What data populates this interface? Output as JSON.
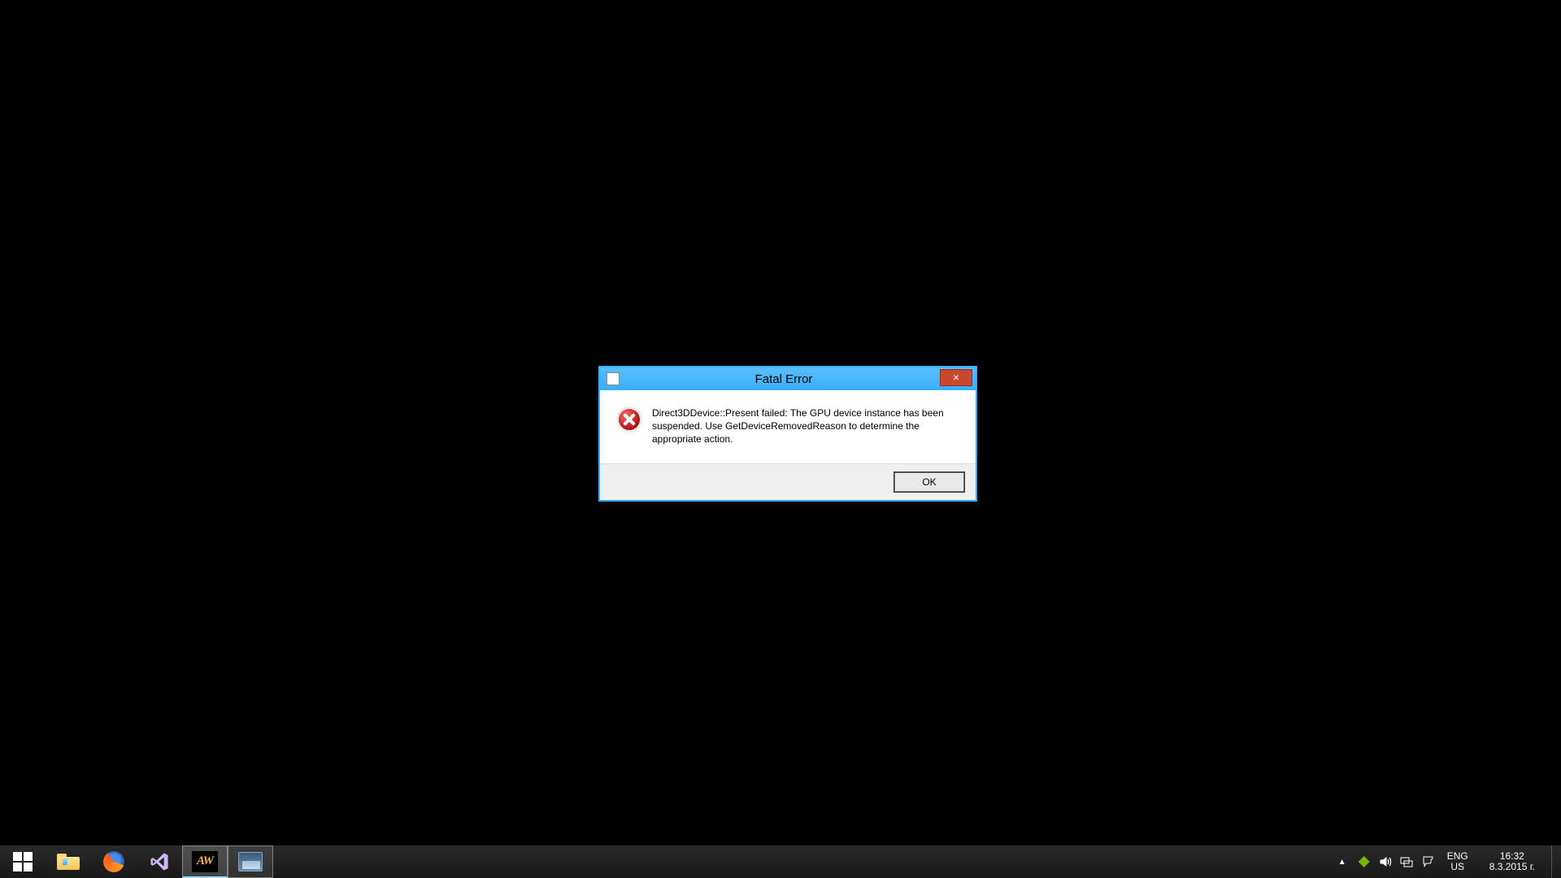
{
  "dialog": {
    "title": "Fatal Error",
    "message": "Direct3DDevice::Present failed: The GPU device instance has been suspended. Use GetDeviceRemovedReason to determine the appropriate action.",
    "ok_label": "OK",
    "close_label": "×"
  },
  "taskbar": {
    "items": [
      {
        "name": "start-button"
      },
      {
        "name": "file-explorer"
      },
      {
        "name": "firefox"
      },
      {
        "name": "visual-studio"
      },
      {
        "name": "aw-application",
        "label": "AW"
      },
      {
        "name": "generic-application"
      }
    ]
  },
  "tray": {
    "lang_primary": "ENG",
    "lang_secondary": "US",
    "time": "16:32",
    "date": "8.3.2015 г."
  }
}
